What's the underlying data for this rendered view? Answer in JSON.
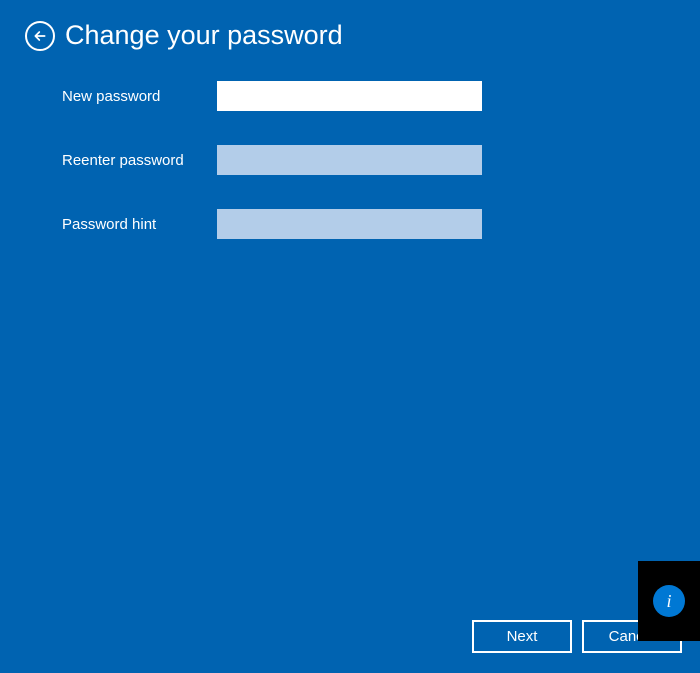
{
  "header": {
    "title": "Change your password"
  },
  "form": {
    "new_password": {
      "label": "New password",
      "value": ""
    },
    "reenter_password": {
      "label": "Reenter password",
      "value": ""
    },
    "password_hint": {
      "label": "Password hint",
      "value": ""
    }
  },
  "footer": {
    "next_label": "Next",
    "cancel_label": "Cancel"
  },
  "info_icon": "i",
  "colors": {
    "background": "#0063b1",
    "input_active": "#ffffff",
    "input_inactive": "#b3cde9",
    "overlay_black": "#000000",
    "info_blue": "#0078d4"
  }
}
